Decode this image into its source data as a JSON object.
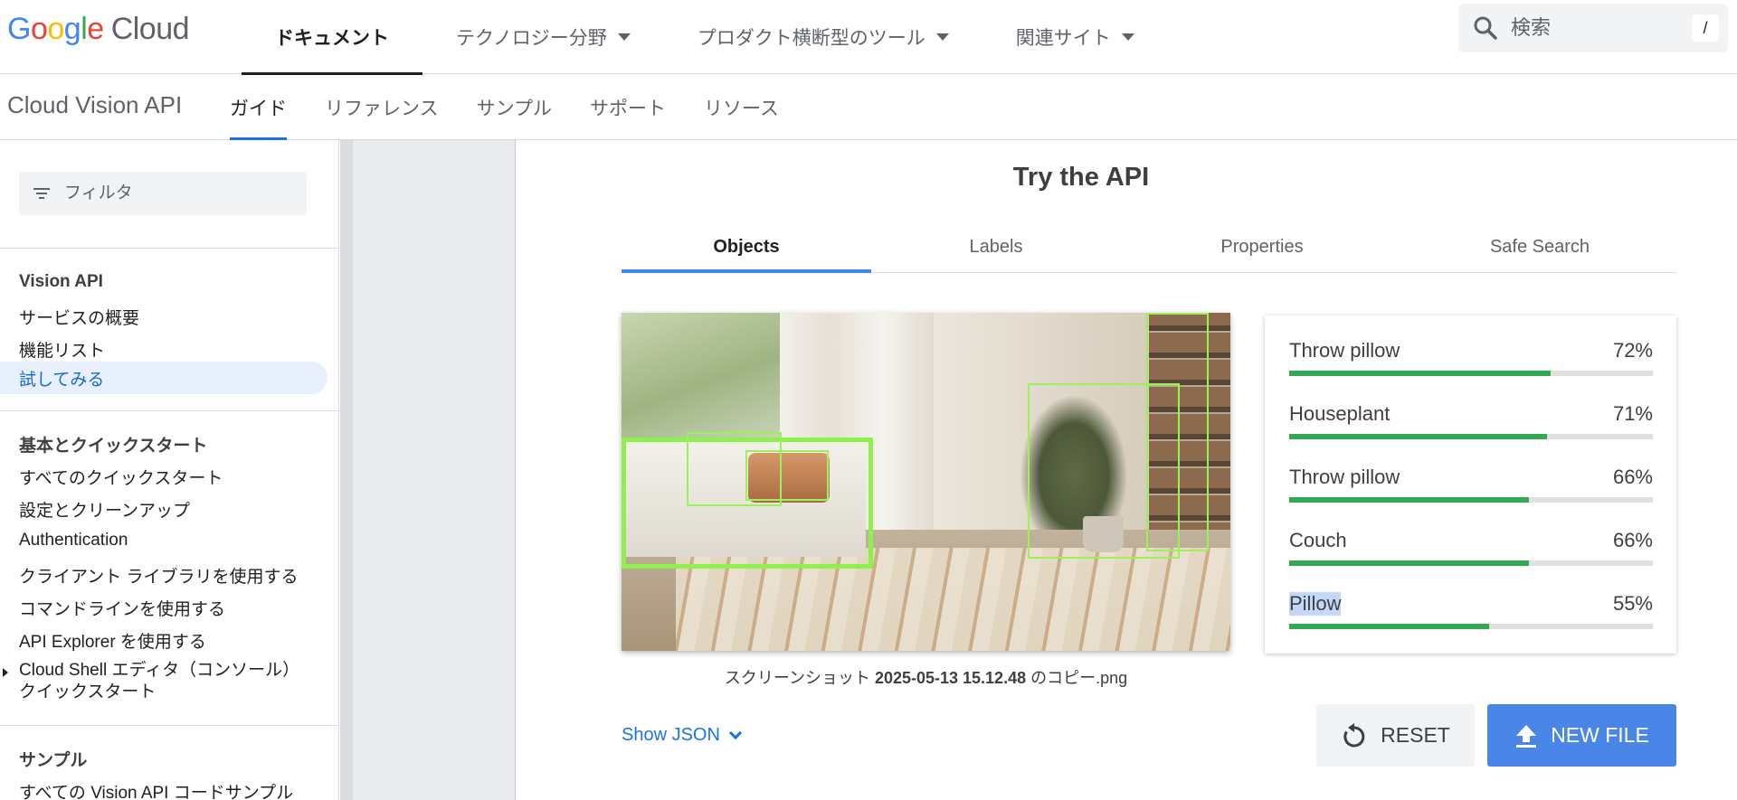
{
  "header": {
    "logo_parts": [
      "G",
      "o",
      "o",
      "g",
      "l",
      "e"
    ],
    "logo_suffix": "Cloud",
    "nav": [
      {
        "label": "ドキュメント",
        "active": true
      },
      {
        "label": "テクノロジー分野"
      },
      {
        "label": "プロダクト横断型のツール"
      },
      {
        "label": "関連サイト"
      }
    ],
    "search_placeholder": "検索",
    "search_shortcut": "/"
  },
  "subheader": {
    "product": "Cloud Vision API",
    "tabs": [
      "ガイド",
      "リファレンス",
      "サンプル",
      "サポート",
      "リソース"
    ]
  },
  "sidebar": {
    "filter_placeholder": "フィルタ",
    "section1_title": "Vision API",
    "section1_items": [
      "サービスの概要",
      "機能リスト",
      "試してみる"
    ],
    "section2_title": "基本とクイックスタート",
    "section2_items": [
      "すべてのクイックスタート",
      "設定とクリーンアップ",
      "Authentication",
      "クライアント ライブラリを使用する",
      "コマンドラインを使用する",
      "API Explorer を使用する"
    ],
    "cloud_shell_line1": "Cloud Shell エディタ（コンソール）",
    "cloud_shell_line2": "クイックスタート",
    "section3_title": "サンプル",
    "section3_items": [
      "すべての Vision API コードサンプル"
    ]
  },
  "main": {
    "title": "Try the API",
    "tabs": [
      "Objects",
      "Labels",
      "Properties",
      "Safe Search"
    ],
    "caption_prefix": "スクリーンショット ",
    "caption_bold": "2025-05-13 15.12.48",
    "caption_suffix": " のコピー.png",
    "results": [
      {
        "label": "Throw pillow",
        "percent": "72%",
        "value": 72
      },
      {
        "label": "Houseplant",
        "percent": "71%",
        "value": 71
      },
      {
        "label": "Throw pillow",
        "percent": "66%",
        "value": 66
      },
      {
        "label": "Couch",
        "percent": "66%",
        "value": 66
      },
      {
        "label": "Pillow",
        "percent": "55%",
        "value": 55
      }
    ],
    "show_json": "Show JSON",
    "reset_label": "RESET",
    "new_file_label": "NEW FILE"
  },
  "colors": {
    "accent": "#1a73e8",
    "bar_fill": "#34a853",
    "bbox": "#9cf05a",
    "new_file_button": "#4a86e8"
  },
  "icons": [
    "search-icon",
    "filter-icon",
    "caret-down-icon",
    "chevron-down-icon",
    "reset-icon",
    "upload-icon"
  ]
}
